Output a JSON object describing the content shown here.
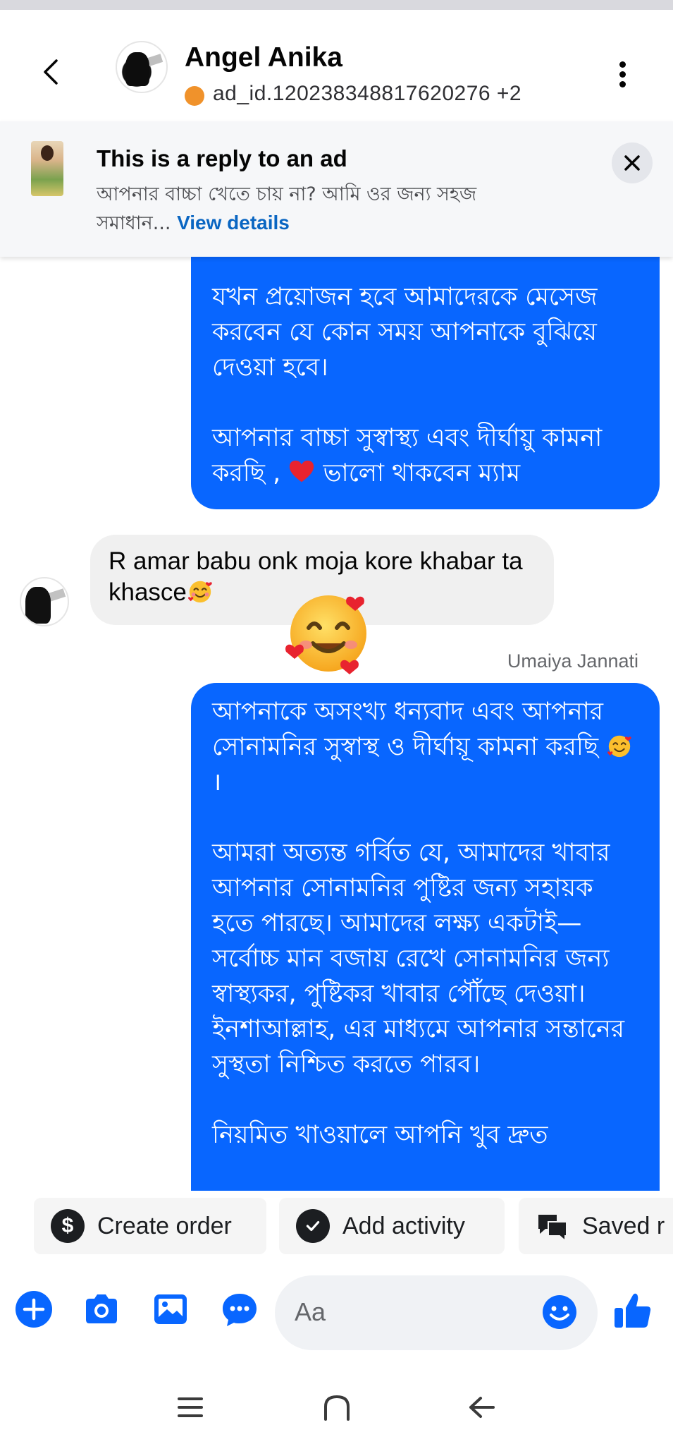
{
  "header": {
    "contact_name": "Angel Anika",
    "subtitle": "ad_id.120238348817620276 +2",
    "presence_color": "#f0922b",
    "icons": {
      "back": "chevron-left-icon",
      "more": "more-vertical-icon"
    }
  },
  "ad_banner": {
    "title": "This is a reply to an ad",
    "body": "আপনার বাচ্চা খেতে চায় না? আমি ওর জন্য সহজ সমাধান...",
    "link": "View details",
    "close_icon": "close-icon"
  },
  "messages": {
    "outgoing_1": {
      "p1": "যখন প্রয়োজন হবে আমাদেরকে মেসেজ করবেন যে কোন সময় আপনাকে বুঝিয়ে দেওয়া হবে।",
      "p2_before": "আপনার বাচ্চা সুস্বাস্থ্য এবং দীর্ঘায়ু কামনা করছি , ",
      "p2_after": " ভালো থাকবেন ম্যাম",
      "emoji": "red-heart-icon"
    },
    "incoming_1": {
      "text": "R amar babu onk moja kore khabar ta khasce",
      "emoji": "smiling-face-with-hearts-icon",
      "reaction": "smiling-face-with-hearts-icon"
    },
    "sender_label": "Umaiya Jannati",
    "outgoing_2": {
      "p1_before": "আপনাকে অসংখ্য ধন্যবাদ এবং আপনার সোনামনির সুস্বাস্থ ও দীর্ঘায়ূ কামনা করছি ",
      "p1_after": "।",
      "p2": "আমরা অত্যন্ত গর্বিত যে, আমাদের খাবার আপনার সোনামনির পুষ্টির জন্য সহায়ক হতে পারছে। আমাদের লক্ষ্য একটাই—সর্বোচ্চ মান বজায় রেখে সোনামনির জন্য স্বাস্থ্যকর, পুষ্টিকর খাবার পৌঁছে দেওয়া। ইনশাআল্লাহ, এর মাধ্যমে আপনার সন্তানের সুস্থতা নিশ্চিত করতে পারব।",
      "p3": "নিয়মিত খাওয়ালে আপনি খুব দ্রুত"
    }
  },
  "quick_actions": [
    {
      "label": "Create order",
      "icon": "dollar-icon"
    },
    {
      "label": "Add activity",
      "icon": "check-circle-icon"
    },
    {
      "label": "Saved r",
      "icon": "chat-bubbles-icon"
    }
  ],
  "composer": {
    "placeholder": "Aa",
    "accent": "#0866ff",
    "icons": [
      "plus-icon",
      "camera-icon",
      "gallery-icon",
      "chat-bubble-icon",
      "emoji-icon",
      "thumbs-up-icon"
    ]
  },
  "system_nav": {
    "icons": [
      "recent-apps-icon",
      "home-icon",
      "back-icon"
    ]
  }
}
